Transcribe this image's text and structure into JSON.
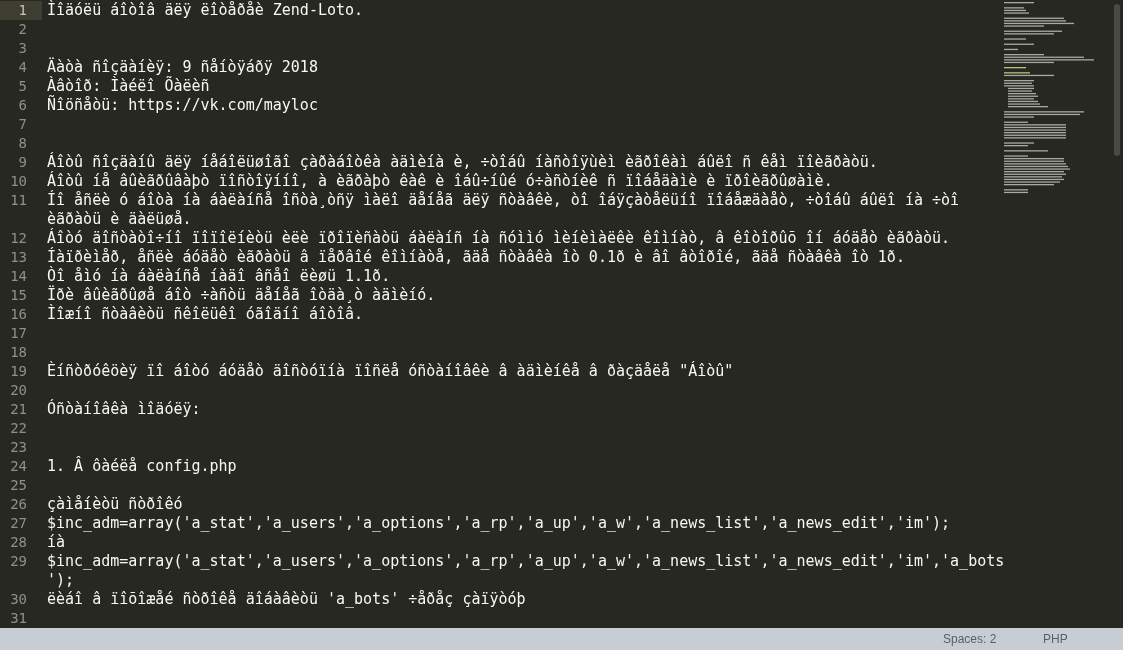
{
  "editor": {
    "lines": [
      {
        "number": "1",
        "current": true,
        "rows": [
          "Ìîäóëü áîòîâ äëÿ ëîòåðåè Zend-Loto."
        ]
      },
      {
        "number": "2",
        "current": false
      },
      {
        "number": "3",
        "current": false
      },
      {
        "number": "4",
        "current": false,
        "rows": [
          "Äàòà ñîçäàíèÿ: 9 ñåíòÿáðÿ 2018"
        ]
      },
      {
        "number": "5",
        "current": false,
        "rows": [
          "Àâòîð: Ìàéëî Õàëèñ"
        ]
      },
      {
        "number": "6",
        "current": false,
        "rows": [
          "Ñîöñåòü: https://vk.com/mayloc"
        ]
      },
      {
        "number": "7",
        "current": false
      },
      {
        "number": "8",
        "current": false
      },
      {
        "number": "9",
        "current": false,
        "rows": [
          "Áîòû ñîçäàíû äëÿ íåáîëüøîãî çàðàáîòêà àäìèíà è, ÷òîáû íàñòîÿùèì èãðîêàì áûëî ñ êåì ïîèãðàòü."
        ]
      },
      {
        "number": "10",
        "current": false,
        "rows": [
          "Áîòû íå âûèãðûâàþò ïîñòîÿííî, à èãðàþò êàê è îáû÷íûé ó÷àñòíèê ñ ïîáåäàìè è ïðîèãðûøàìè."
        ]
      },
      {
        "number": "11",
        "current": false,
        "rows": [
          "Íî åñëè ó áîòà íà áàëàíñå îñòà¸òñÿ ìàëî äåíåã äëÿ ñòàâêè, òî îáÿçàòåëüíî ïîáåæäàåò, ÷òîáû áûëî íà ÷òî",
          "èãðàòü è äàëüøå."
        ]
      },
      {
        "number": "12",
        "current": false,
        "rows": [
          "Áîòó äîñòàòî÷íî ïîïîëíèòü èëè ïðîïèñàòü áàëàíñ íà ñóììó ìèíèìàëêè êîìíàò, â êîòîðûõ îí áóäåò èãðàòü."
        ]
      },
      {
        "number": "13",
        "current": false,
        "rows": [
          "Íàïðèìåð, åñëè áóäåò èãðàòü â ïåðâîé êîìíàòå, ãäå ñòàâêà îò 0.1ð è âî âòîðîé, ãäå ñòàâêà îò 1ð."
        ]
      },
      {
        "number": "14",
        "current": false,
        "rows": [
          "Òî åìó íà áàëàíñå íàäî âñåî ëèøü 1.1ð."
        ]
      },
      {
        "number": "15",
        "current": false,
        "rows": [
          "Ïðè âûèãðûøå áîò ÷àñòü äåíåã îòäà¸ò àäìèíó."
        ]
      },
      {
        "number": "16",
        "current": false,
        "rows": [
          "Ìîæíî ñòàâèòü ñêîëüêî óãîäíî áîòîâ."
        ]
      },
      {
        "number": "17",
        "current": false
      },
      {
        "number": "18",
        "current": false
      },
      {
        "number": "19",
        "current": false,
        "rows": [
          "Èíñòðóêöèÿ ïî áîòó áóäåò äîñòóïíà ïîñëå óñòàíîâêè â àäìèíêå â ðàçäåëå \"Áîòû\""
        ]
      },
      {
        "number": "20",
        "current": false
      },
      {
        "number": "21",
        "current": false,
        "rows": [
          "Óñòàíîâêà ìîäóëÿ:"
        ]
      },
      {
        "number": "22",
        "current": false
      },
      {
        "number": "23",
        "current": false
      },
      {
        "number": "24",
        "current": false,
        "rows": [
          "1. Â ôàéëå config.php"
        ]
      },
      {
        "number": "25",
        "current": false
      },
      {
        "number": "26",
        "current": false,
        "rows": [
          "çàìåíèòü ñòðîêó"
        ]
      },
      {
        "number": "27",
        "current": false,
        "rows": [
          "$inc_adm=array('a_stat','a_users','a_options','a_rp','a_up','a_w','a_news_list','a_news_edit','im');"
        ]
      },
      {
        "number": "28",
        "current": false,
        "rows": [
          "íà"
        ]
      },
      {
        "number": "29",
        "current": false,
        "rows": [
          "$inc_adm=array('a_stat','a_users','a_options','a_rp','a_up','a_w','a_news_list','a_news_edit','im','a_bots",
          "');"
        ]
      },
      {
        "number": "30",
        "current": false,
        "rows": [
          "ëèáî â ïîõîæåé ñòðîêå äîáàâèòü 'a_bots' ÷åðåç çàïÿòóþ"
        ]
      },
      {
        "number": "31",
        "current": false
      }
    ]
  },
  "status_bar": {
    "items": [
      "Spaces: 2",
      "PHP"
    ]
  }
}
